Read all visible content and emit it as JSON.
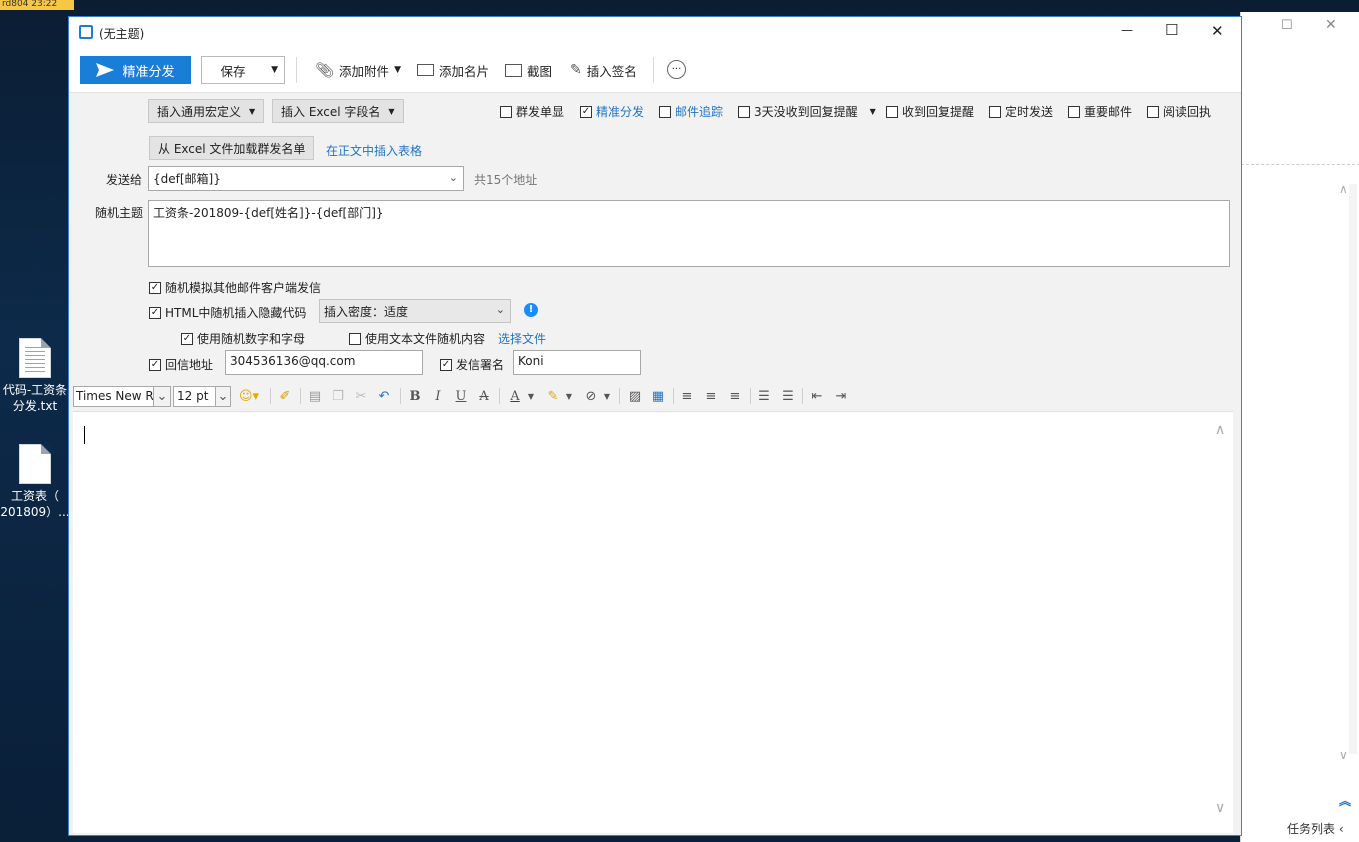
{
  "clock": {
    "text": "rd804 23:22"
  },
  "desktop": {
    "icons": [
      {
        "label": "代码-工资条\n分发.txt"
      },
      {
        "label": "工资表（\n201809）..."
      }
    ]
  },
  "background_window": {
    "taskbar_label": "任务列表 ‹"
  },
  "window": {
    "title": "(无主题)",
    "controls": {
      "minimize": "—",
      "maximize": "☐",
      "close": "✕"
    }
  },
  "toolbar": {
    "send_label": "精准分发",
    "save_label": "保存",
    "attach_label": "添加附件",
    "card_label": "添加名片",
    "screenshot_label": "截图",
    "signature_label": "插入签名",
    "more_label": "···"
  },
  "options": {
    "macro_btn": "插入通用宏定义",
    "excel_field_btn": "插入 Excel 字段名",
    "load_excel_btn": "从 Excel 文件加载群发名单",
    "insert_table_link": "在正文中插入表格",
    "checkboxes": [
      {
        "label": "群发单显",
        "checked": false,
        "link": false
      },
      {
        "label": "精准分发",
        "checked": true,
        "link": true
      },
      {
        "label": "邮件追踪",
        "checked": false,
        "link": true
      },
      {
        "label": "3天没收到回复提醒",
        "checked": false,
        "link": false
      },
      {
        "label": "收到回复提醒",
        "checked": false,
        "link": false
      },
      {
        "label": "定时发送",
        "checked": false,
        "link": false
      },
      {
        "label": "重要邮件",
        "checked": false,
        "link": false
      },
      {
        "label": "阅读回执",
        "checked": false,
        "link": false
      }
    ]
  },
  "recipients": {
    "label": "发送给",
    "value": "{def[邮箱]}",
    "count_text": "共15个地址"
  },
  "subject": {
    "label": "随机主题",
    "value": "工资条-201809-{def[姓名]}-{def[部门]}"
  },
  "random": {
    "simulate_label": "随机模拟其他邮件客户端发信",
    "simulate_checked": true,
    "hidden_code_label": "HTML中随机插入隐藏代码",
    "hidden_code_checked": true,
    "density_value": "插入密度：适度",
    "random_num_label": "使用随机数字和字母",
    "random_num_checked": true,
    "text_file_label": "使用文本文件随机内容",
    "text_file_checked": false,
    "choose_file_link": "选择文件",
    "reply_label": "回信地址",
    "reply_checked": true,
    "reply_value": "304536136@qq.com",
    "sender_label": "发信署名",
    "sender_checked": true,
    "sender_value": "Koni"
  },
  "editor": {
    "font_name": "Times New Ro",
    "font_size": "12 pt",
    "bold": "B",
    "italic": "I",
    "underline": "U",
    "strike": "A",
    "font_color": "A"
  },
  "colors": {
    "accent": "#1a7ed8",
    "link": "#1f74c8",
    "info": "#1a8cff"
  }
}
